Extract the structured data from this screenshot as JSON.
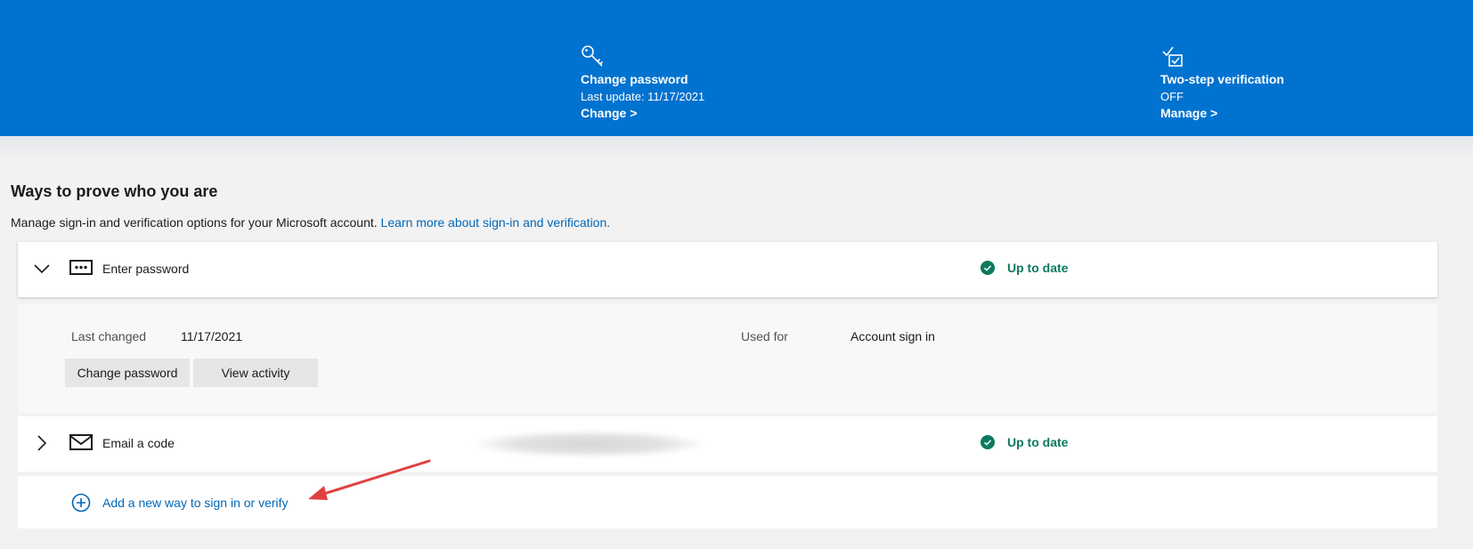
{
  "banner": {
    "password": {
      "title": "Change password",
      "subtitle": "Last update: 11/17/2021",
      "link": "Change >",
      "icon": "key-icon"
    },
    "two_step": {
      "title": "Two-step verification",
      "subtitle": "OFF",
      "link": "Manage >",
      "icon": "checklist-icon"
    }
  },
  "section": {
    "title": "Ways to prove who you are",
    "description": "Manage sign-in and verification options for your Microsoft account.",
    "learn_more": "Learn more about sign-in and verification."
  },
  "methods": {
    "password": {
      "label": "Enter password",
      "status": "Up to date",
      "last_changed_label": "Last changed",
      "last_changed_value": "11/17/2021",
      "used_for_label": "Used for",
      "used_for_value": "Account sign in",
      "change_button": "Change password",
      "activity_button": "View activity"
    },
    "email": {
      "label": "Email a code",
      "status": "Up to date"
    }
  },
  "add_method": {
    "label": "Add a new way to sign in or verify"
  },
  "colors": {
    "banner": "#0072cf",
    "link": "#0067b8",
    "status_green": "#0d7a5f",
    "annotation_arrow": "#e04040"
  }
}
